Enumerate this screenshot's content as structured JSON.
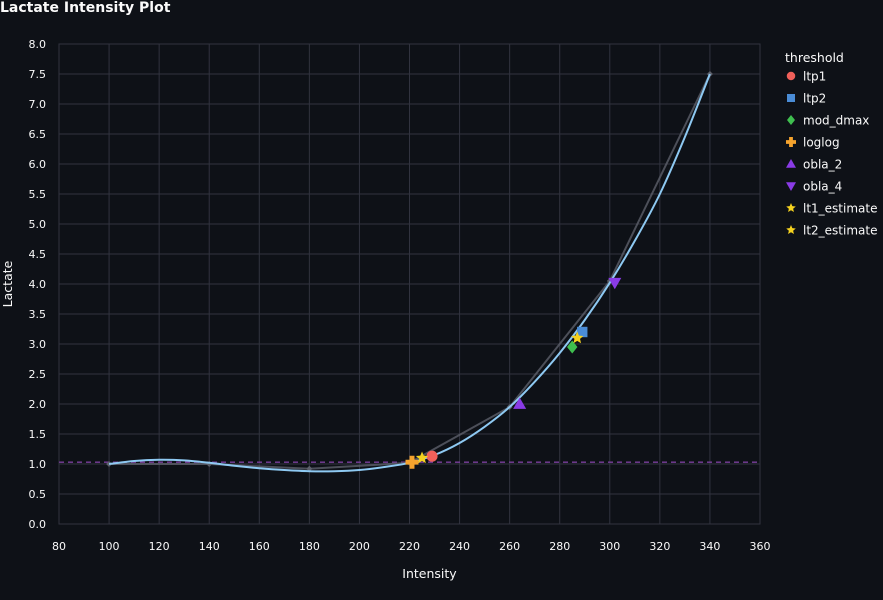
{
  "chart_data": {
    "type": "line",
    "title": "Lactate Intensity Plot",
    "xlabel": "Intensity",
    "ylabel": "Lactate",
    "xlim": [
      80,
      360
    ],
    "ylim": [
      0,
      8
    ],
    "xticks": [
      80,
      100,
      120,
      140,
      160,
      180,
      200,
      220,
      240,
      260,
      280,
      300,
      320,
      340,
      360
    ],
    "yticks": [
      "0.0",
      "0.5",
      "1.0",
      "1.5",
      "2.0",
      "2.5",
      "3.0",
      "3.5",
      "4.0",
      "4.5",
      "5.0",
      "5.5",
      "6.0",
      "6.5",
      "7.0",
      "7.5",
      "8.0"
    ],
    "grid": true,
    "raw_data": {
      "x": [
        100,
        140,
        180,
        220,
        260,
        300,
        340
      ],
      "y": [
        1.0,
        1.0,
        0.92,
        1.02,
        1.95,
        4.05,
        7.5
      ]
    },
    "fitted_curve": {
      "x": [
        100,
        110,
        120,
        130,
        140,
        150,
        160,
        170,
        180,
        190,
        200,
        210,
        220,
        230,
        240,
        250,
        260,
        270,
        280,
        290,
        300,
        310,
        320,
        330,
        340
      ],
      "y": [
        1.0,
        1.05,
        1.07,
        1.06,
        1.02,
        0.97,
        0.93,
        0.9,
        0.88,
        0.88,
        0.9,
        0.95,
        1.02,
        1.15,
        1.35,
        1.62,
        1.95,
        2.37,
        2.85,
        3.4,
        4.02,
        4.72,
        5.5,
        6.45,
        7.5
      ]
    },
    "baseline": 1.03,
    "legend_title": "threshold",
    "legend_position": "right",
    "thresholds": [
      {
        "name": "ltp1",
        "x": 229,
        "y": 1.13,
        "marker": "circle",
        "color": "#f0605a"
      },
      {
        "name": "ltp2",
        "x": 289,
        "y": 3.2,
        "marker": "square",
        "color": "#4a8cd6"
      },
      {
        "name": "mod_dmax",
        "x": 285,
        "y": 2.95,
        "marker": "diamond",
        "color": "#3fbf4f"
      },
      {
        "name": "loglog",
        "x": 221,
        "y": 1.03,
        "marker": "cross",
        "color": "#f5a32d"
      },
      {
        "name": "obla_2",
        "x": 264,
        "y": 2.0,
        "marker": "triangle-up",
        "color": "#8a3be6"
      },
      {
        "name": "obla_4",
        "x": 302,
        "y": 4.02,
        "marker": "triangle-down",
        "color": "#8a3be6"
      },
      {
        "name": "lt1_estimate",
        "x": 225,
        "y": 1.1,
        "marker": "star",
        "color": "#f5d21f"
      },
      {
        "name": "lt2_estimate",
        "x": 287,
        "y": 3.1,
        "marker": "star",
        "color": "#f5d21f"
      }
    ]
  },
  "colors": {
    "background": "#0e1117",
    "grid": "#31333f",
    "curve": "#8ec9f2",
    "raw_line": "#5c5f6a",
    "baseline": "#7a3e9c"
  }
}
